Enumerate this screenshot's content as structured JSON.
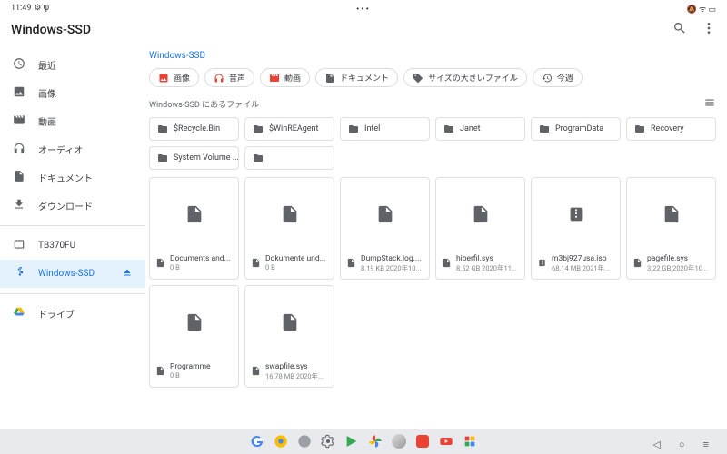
{
  "status": {
    "time": "11:49"
  },
  "header": {
    "title": "Windows-SSD"
  },
  "sidebar": {
    "items": [
      {
        "label": "最近"
      },
      {
        "label": "画像"
      },
      {
        "label": "動画"
      },
      {
        "label": "オーディオ"
      },
      {
        "label": "ドキュメント"
      },
      {
        "label": "ダウンロード"
      }
    ],
    "storage": [
      {
        "label": "TB370FU"
      },
      {
        "label": "Windows-SSD"
      }
    ],
    "cloud": [
      {
        "label": "ドライブ"
      }
    ]
  },
  "breadcrumb": "Windows-SSD",
  "chips": {
    "image": "画像",
    "audio": "音声",
    "video": "動画",
    "doc": "ドキュメント",
    "large": "サイズの大きいファイル",
    "week": "今週"
  },
  "section_title": "Windows-SSD にあるファイル",
  "folders": [
    {
      "name": "$Recycle.Bin"
    },
    {
      "name": "$WinREAgent"
    },
    {
      "name": "Intel"
    },
    {
      "name": "Janet"
    },
    {
      "name": "ProgramData"
    },
    {
      "name": "Recovery"
    },
    {
      "name": "System Volume ..."
    },
    {
      "name": ""
    }
  ],
  "files": [
    {
      "name": "Documents and...",
      "meta": "0 B",
      "type": "file"
    },
    {
      "name": "Dokumente und...",
      "meta": "0 B",
      "type": "file"
    },
    {
      "name": "DumpStack.log....",
      "meta": "8.19 KB 2020年10...",
      "type": "file"
    },
    {
      "name": "hiberfil.sys",
      "meta": "8.52 GB 2020年11...",
      "type": "file"
    },
    {
      "name": "m3bj927usa.iso",
      "meta": "68.14 MB 2021年...",
      "type": "zip"
    },
    {
      "name": "pagefile.sys",
      "meta": "3.22 GB 2020年10...",
      "type": "file"
    },
    {
      "name": "Programme",
      "meta": "0 B",
      "type": "file"
    },
    {
      "name": "swapfile.sys",
      "meta": "16.78 MB 2020年...",
      "type": "file"
    }
  ]
}
